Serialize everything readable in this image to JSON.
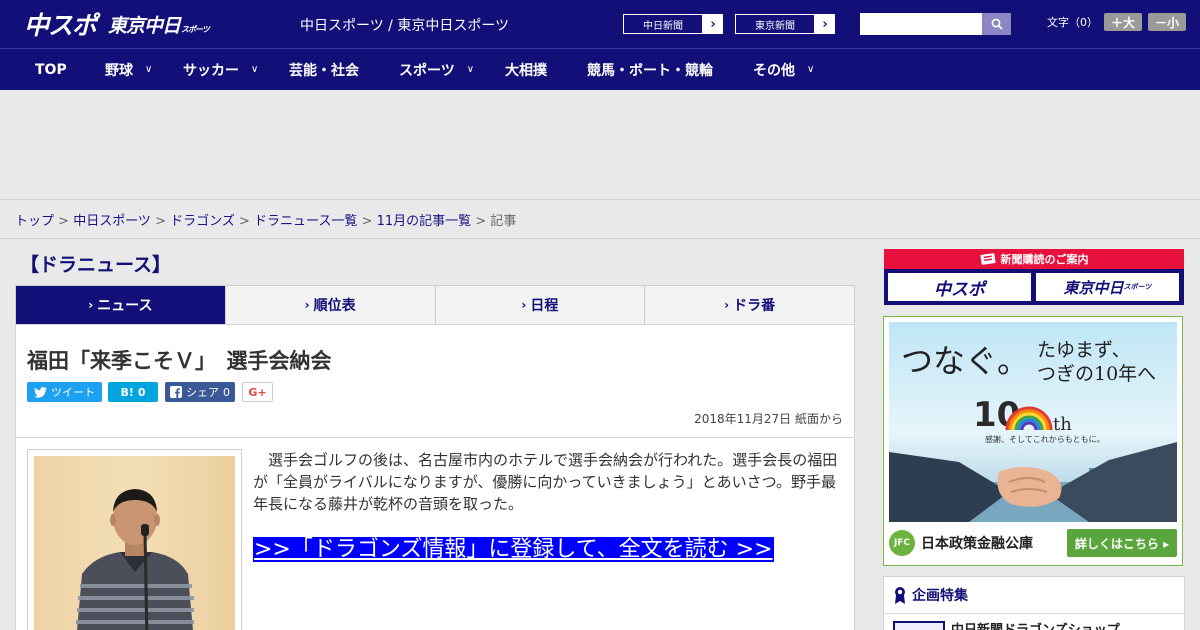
{
  "header": {
    "logo_main": "中スポ",
    "logo_sub": "東京中日",
    "logo_sub_small": "スポーツ",
    "site_name": "中日スポーツ / 東京中日スポーツ",
    "paper_links": [
      {
        "label": "中日新聞",
        "arrow": "›"
      },
      {
        "label": "東京新聞",
        "arrow": "›"
      }
    ],
    "search": {
      "value": "",
      "placeholder": ""
    },
    "font_label": "文字（0）",
    "font_bigger": "＋大",
    "font_smaller": "－小"
  },
  "nav": {
    "items": [
      {
        "label": "TOP",
        "chev": ""
      },
      {
        "label": "野球",
        "chev": "∨"
      },
      {
        "label": "サッカー",
        "chev": "∨"
      },
      {
        "label": "芸能・社会",
        "chev": ""
      },
      {
        "label": "スポーツ",
        "chev": "∨"
      },
      {
        "label": "大相撲",
        "chev": ""
      },
      {
        "label": "競馬・ボート・競輪",
        "chev": ""
      },
      {
        "label": "その他",
        "chev": "∨"
      }
    ]
  },
  "breadcrumb": {
    "items": [
      "トップ",
      "中日スポーツ",
      "ドラゴンズ",
      "ドラニュース一覧",
      "11月の記事一覧"
    ],
    "sep": " > ",
    "current": "記事"
  },
  "section_title": "【ドラニュース】",
  "tabs": [
    {
      "label": "ニュース",
      "arrow": "›"
    },
    {
      "label": "順位表",
      "arrow": "›"
    },
    {
      "label": "日程",
      "arrow": "›"
    },
    {
      "label": "ドラ番",
      "arrow": "›"
    }
  ],
  "article": {
    "title": "福田「来季こそＶ」　選手会納会",
    "share": {
      "tweet": "ツイート",
      "hatena_label": "B!",
      "hatena_count": "0",
      "facebook": "シェア",
      "facebook_count": "0",
      "gplus": "G+"
    },
    "date": "2018年11月27日 紙面から",
    "body": "　選手会ゴルフの後は、名古屋市内のホテルで選手会納会が行われた。選手会長の福田が「全員がライバルになりますが、優勝に向かっていきましょう」とあいさつ。野手最年長になる藤井が乾杯の音頭を取った。",
    "read_more": ">>「ドラゴンズ情報」に登録して、全文を読む >>"
  },
  "sidebar": {
    "subscribe_title": "新聞購読のご案内",
    "subscribe_options": [
      "中スポ",
      "東京中日"
    ],
    "subscribe_option_small": "スポーツ",
    "ad": {
      "headline_1": "つなぐ。",
      "headline_2": "たゆまず、",
      "headline_3": "つぎの10年へ",
      "anniv": "10",
      "anniv_suffix": "th",
      "tagline": "感謝、そしてこれからもともに。",
      "org_logo": "JFC",
      "org_name": "日本政策金融公庫",
      "button": "詳しくはこちら ▸"
    },
    "feature_title": "企画特集",
    "feature_item": "中日新聞ドラゴンズショップ"
  }
}
